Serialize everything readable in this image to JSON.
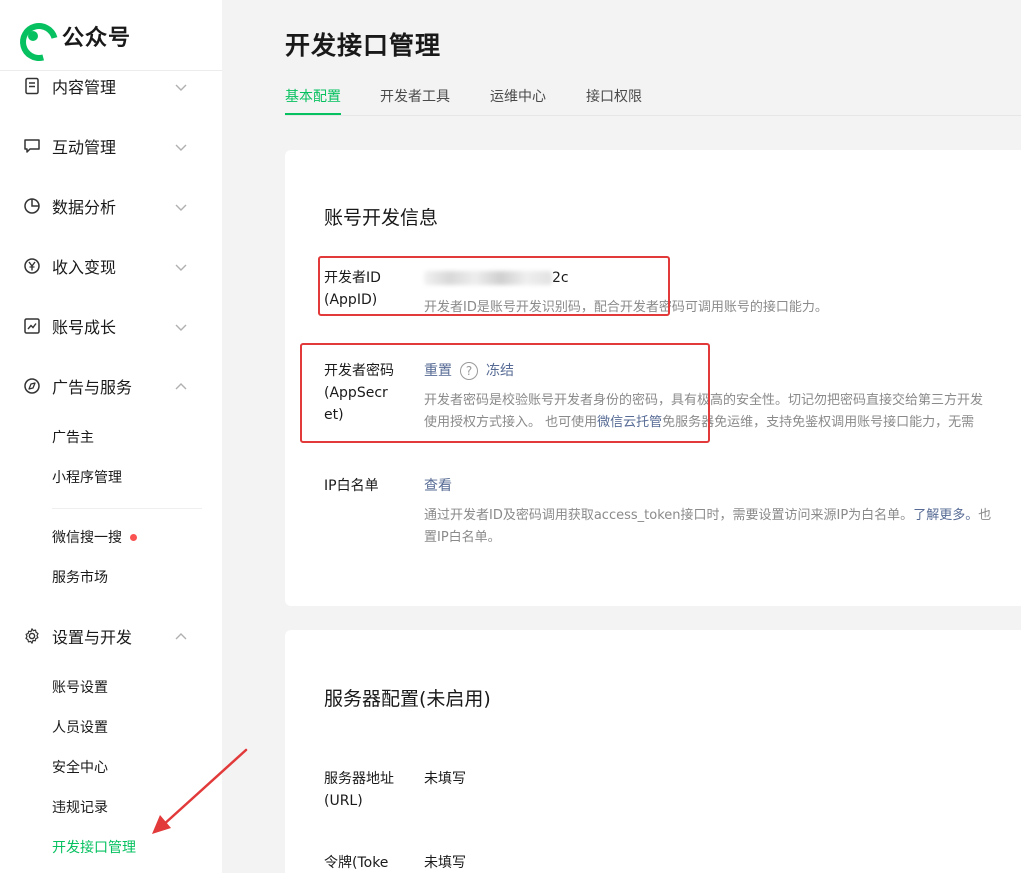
{
  "brand": {
    "name": "公众号"
  },
  "sidebar": {
    "items": [
      {
        "label": "内容管理",
        "icon": "document-icon"
      },
      {
        "label": "互动管理",
        "icon": "chat-bubble-icon"
      },
      {
        "label": "数据分析",
        "icon": "pie-chart-icon"
      },
      {
        "label": "收入变现",
        "icon": "yen-circle-icon"
      },
      {
        "label": "账号成长",
        "icon": "trend-chart-icon"
      },
      {
        "label": "广告与服务",
        "icon": "compass-icon"
      },
      {
        "label": "设置与开发",
        "icon": "gear-icon"
      }
    ],
    "ads_sub": [
      "广告主",
      "小程序管理",
      "微信搜一搜",
      "服务市场"
    ],
    "settings_sub": [
      "账号设置",
      "人员设置",
      "安全中心",
      "违规记录",
      "开发接口管理"
    ]
  },
  "main": {
    "title": "开发接口管理",
    "tabs": [
      "基本配置",
      "开发者工具",
      "运维中心",
      "接口权限"
    ],
    "account_section": {
      "title": "账号开发信息",
      "appid_label": "开发者ID\n(AppID)",
      "appid_tail": "2c",
      "appid_desc": "开发者ID是账号开发识别码，配合开发者密码可调用账号的接口能力。",
      "secret_label": "开发者密码\n(AppSecret)",
      "secret_reset": "重置",
      "secret_help": "?",
      "secret_freeze": "冻结",
      "secret_desc1": "开发者密码是校验账号开发者身份的密码，具有极高的安全性。切记勿把密码直接交给第三方开发",
      "secret_desc2_a": "使用授权方式接入。 也可使用",
      "secret_desc2_link": "微信云托管",
      "secret_desc2_b": "免服务器免运维，支持免鉴权调用账号接口能力，无需",
      "ip_label": "IP白名单",
      "ip_view": "查看",
      "ip_desc1_a": "通过开发者ID及密码调用获取access_token接口时，需要设置访问来源IP为白名单。",
      "ip_desc1_link": "了解更多。",
      "ip_desc1_b": "也",
      "ip_desc2": "置IP白名单。"
    },
    "server_section": {
      "title": "服务器配置(未启用)",
      "url_label": "服务器地址\n(URL)",
      "url_value": "未填写",
      "token_label": "令牌(Toke",
      "token_value": "未填写"
    }
  },
  "colors": {
    "accent": "#07c160",
    "highlight_box": "#e23a3a",
    "link": "#576b95"
  }
}
